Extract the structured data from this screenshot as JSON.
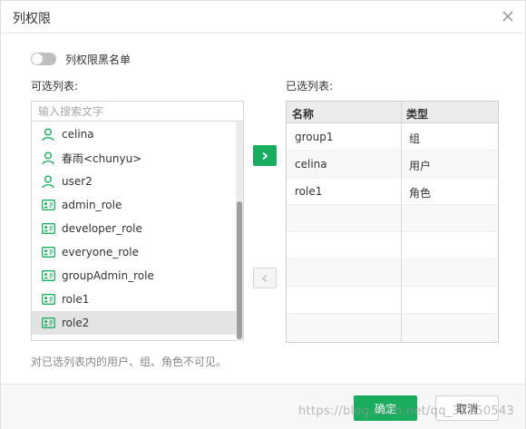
{
  "dialog": {
    "title": "列权限",
    "blacklist_label": "列权限黑名单",
    "blacklist_enabled": false
  },
  "left": {
    "label": "可选列表:",
    "search_placeholder": "输入搜索文字",
    "items": [
      {
        "label": "celina",
        "icon": "user-icon",
        "selected": false
      },
      {
        "label": "春雨<chunyu>",
        "icon": "user-icon",
        "selected": false
      },
      {
        "label": "user2",
        "icon": "user-icon",
        "selected": false
      },
      {
        "label": "admin_role",
        "icon": "role-card-icon",
        "selected": false
      },
      {
        "label": "developer_role",
        "icon": "role-card-icon",
        "selected": false
      },
      {
        "label": "everyone_role",
        "icon": "role-card-icon",
        "selected": false
      },
      {
        "label": "groupAdmin_role",
        "icon": "role-card-icon",
        "selected": false
      },
      {
        "label": "role1",
        "icon": "role-card-icon",
        "selected": false
      },
      {
        "label": "role2",
        "icon": "role-card-icon",
        "selected": true
      }
    ]
  },
  "right": {
    "label": "已选列表:",
    "col_name": "名称",
    "col_type": "类型",
    "rows": [
      {
        "name": "group1",
        "type": "组"
      },
      {
        "name": "celina",
        "type": "用户"
      },
      {
        "name": "role1",
        "type": "角色"
      }
    ]
  },
  "note": "对已选列表内的用户、组、角色不可见。",
  "buttons": {
    "ok": "确定",
    "cancel": "取消"
  },
  "watermark": "https://blog.csdn.net/qq_32150543",
  "colors": {
    "accent": "#1aad5f",
    "icon_green": "#1aad5f",
    "selected_bg": "#e3e3e3"
  }
}
